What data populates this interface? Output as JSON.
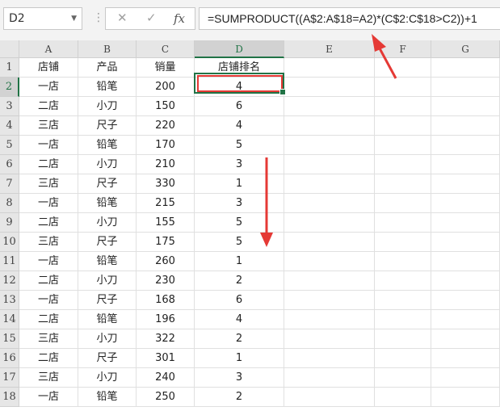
{
  "name_box": {
    "value": "D2"
  },
  "formula_bar": {
    "cancel_icon": "close-icon",
    "enter_icon": "check-icon",
    "fx_label": "fx",
    "formula": "=SUMPRODUCT((A$2:A$18=A2)*(C$2:C$18>C2))+1"
  },
  "columns": [
    "A",
    "B",
    "C",
    "D",
    "E",
    "F",
    "G"
  ],
  "rows": [
    "1",
    "2",
    "3",
    "4",
    "5",
    "6",
    "7",
    "8",
    "9",
    "10",
    "11",
    "12",
    "13",
    "14",
    "15",
    "16",
    "17",
    "18"
  ],
  "headers": {
    "a": "店铺",
    "b": "产品",
    "c": "销量",
    "d": "店铺排名"
  },
  "table": [
    [
      "一店",
      "铅笔",
      "200",
      "4"
    ],
    [
      "二店",
      "小刀",
      "150",
      "6"
    ],
    [
      "三店",
      "尺子",
      "220",
      "4"
    ],
    [
      "一店",
      "铅笔",
      "170",
      "5"
    ],
    [
      "二店",
      "小刀",
      "210",
      "3"
    ],
    [
      "三店",
      "尺子",
      "330",
      "1"
    ],
    [
      "一店",
      "铅笔",
      "215",
      "3"
    ],
    [
      "二店",
      "小刀",
      "155",
      "5"
    ],
    [
      "三店",
      "尺子",
      "175",
      "5"
    ],
    [
      "一店",
      "铅笔",
      "260",
      "1"
    ],
    [
      "二店",
      "小刀",
      "230",
      "2"
    ],
    [
      "一店",
      "尺子",
      "168",
      "6"
    ],
    [
      "二店",
      "铅笔",
      "196",
      "4"
    ],
    [
      "三店",
      "小刀",
      "322",
      "2"
    ],
    [
      "二店",
      "尺子",
      "301",
      "1"
    ],
    [
      "三店",
      "小刀",
      "240",
      "3"
    ],
    [
      "一店",
      "铅笔",
      "250",
      "2"
    ]
  ],
  "selection": {
    "column": "D",
    "row": "2"
  },
  "colors": {
    "accent": "#217346",
    "highlight": "#e53935"
  }
}
